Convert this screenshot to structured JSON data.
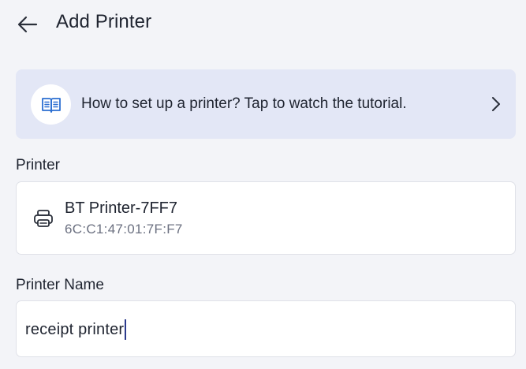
{
  "header": {
    "title": "Add Printer",
    "back_icon": "arrow-left-icon"
  },
  "banner": {
    "icon": "book-icon",
    "text": "How to set up a printer? Tap to watch the tutorial.",
    "chevron_icon": "chevron-right-icon",
    "background": "#e3e7f6",
    "accent": "#2b6fd1"
  },
  "printer_section": {
    "label": "Printer",
    "device": {
      "icon": "printer-icon",
      "name": "BT Printer-7FF7",
      "mac": "6C:C1:47:01:7F:F7"
    }
  },
  "name_section": {
    "label": "Printer Name",
    "value": "receipt printer"
  }
}
